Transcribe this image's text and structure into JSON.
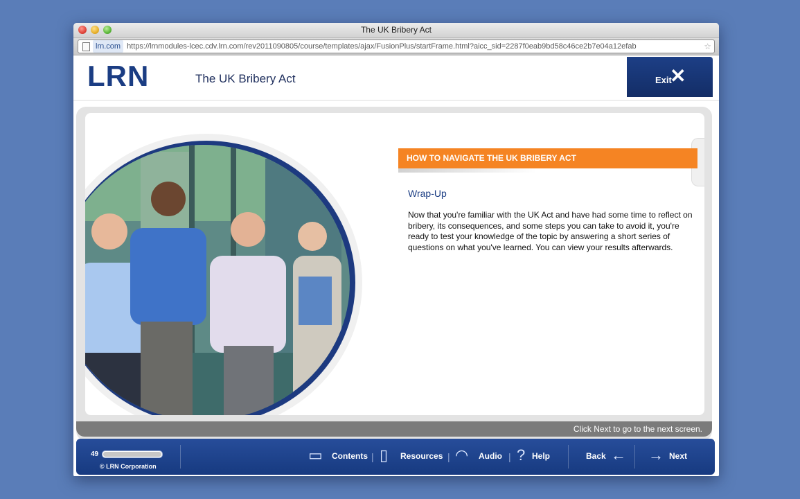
{
  "window": {
    "title": "The UK Bribery Act",
    "url_domain": "lrn.com",
    "url": "https://lrnmodules-lcec.cdv.lrn.com/rev2011090805/course/templates/ajax/FusionPlus/startFrame.html?aicc_sid=2287f0eab9bd58c46ce2b7e04a12efab"
  },
  "header": {
    "logo": "LRN",
    "course_title": "The UK Bribery Act",
    "exit_label": "Exit",
    "exit_icon": "✕"
  },
  "content": {
    "banner": "HOW TO NAVIGATE THE UK BRIBERY ACT",
    "subheading": "Wrap-Up",
    "body": "Now that you're familiar with the UK Act and have had some time to reflect on bribery, its consequences, and some steps you can take to avoid it, you're ready to test your knowledge of the topic by answering a short series of questions on what you've learned. You can view your results afterwards.",
    "hint": "Click Next to go to the next screen."
  },
  "navbar": {
    "progress": {
      "label": "49",
      "percent": 100
    },
    "copyright": "© LRN Corporation",
    "contents": "Contents",
    "resources": "Resources",
    "audio": "Audio",
    "help": "Help",
    "back": "Back",
    "next": "Next",
    "separator": "|"
  },
  "colors": {
    "brand_blue": "#1b3d83",
    "accent_orange": "#f58423",
    "desktop": "#5a7db8"
  }
}
